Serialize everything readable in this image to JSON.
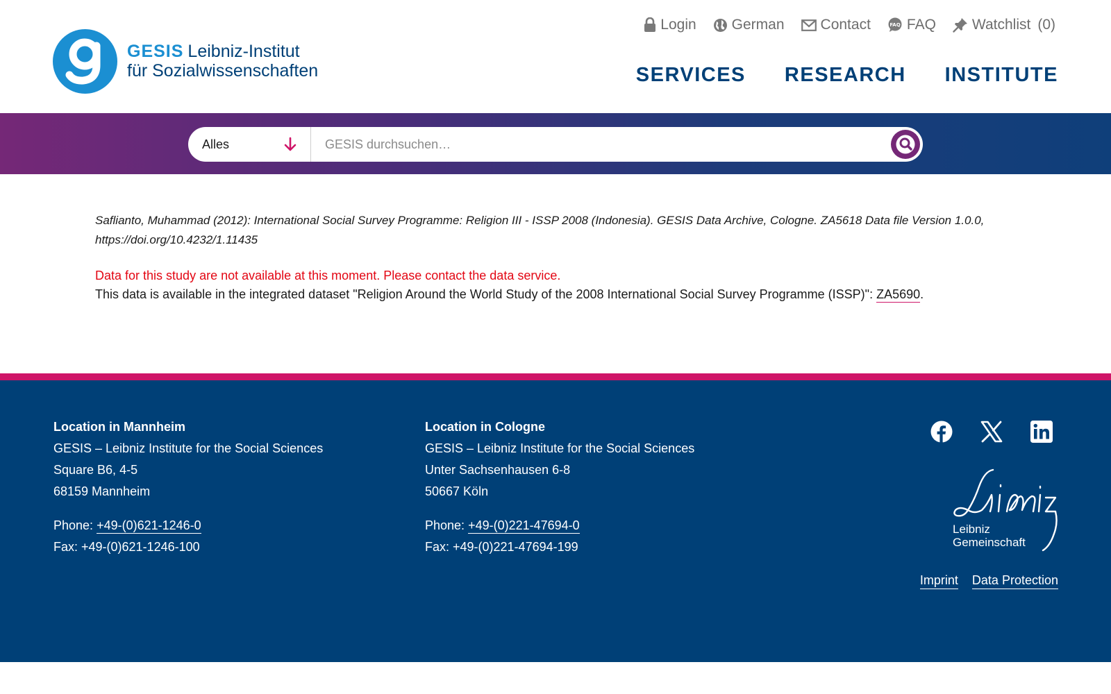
{
  "header": {
    "logo": {
      "brand": "GESIS",
      "line1": "Leibniz-Institut",
      "line2": "für Sozialwissenschaften"
    },
    "utility": {
      "login": "Login",
      "language": "German",
      "contact": "Contact",
      "faq": "FAQ",
      "watchlist": "Watchlist",
      "watchlist_count": "(0)"
    },
    "nav": {
      "services": "SERVICES",
      "research": "RESEARCH",
      "institute": "INSTITUTE"
    }
  },
  "search": {
    "scope_selected": "Alles",
    "placeholder": "GESIS durchsuchen…",
    "value": ""
  },
  "content": {
    "citation": "Saflianto, Muhammad (2012): International Social Survey Programme: Religion III - ISSP 2008 (Indonesia). GESIS Data Archive, Cologne. ZA5618 Data file Version 1.0.0, https://doi.org/10.4232/1.11435",
    "notice": "Data for this study are not available at this moment. Please contact the data service.",
    "available_prefix": "This data is available in the integrated dataset \"Religion Around the World Study of the 2008 International Social Survey Programme (ISSP)\": ",
    "dataset_link": "ZA5690",
    "available_suffix": "."
  },
  "footer": {
    "mannheim": {
      "title": "Location in Mannheim",
      "org": "GESIS – Leibniz Institute for the Social Sciences",
      "street": "Square B6, 4-5",
      "city": "68159 Mannheim",
      "phone_label": "Phone: ",
      "phone": "+49-(0)621-1246-0",
      "fax": "Fax: +49-(0)621-1246-100"
    },
    "cologne": {
      "title": "Location in Cologne",
      "org": "GESIS – Leibniz Institute for the Social Sciences",
      "street": "Unter Sachsenhausen 6-8",
      "city": "50667 Köln",
      "phone_label": "Phone: ",
      "phone": "+49-(0)221-47694-0",
      "fax": "Fax: +49-(0)221-47694-199"
    },
    "leibniz": {
      "line1": "Leibniz",
      "line2": "Gemeinschaft"
    },
    "legal": {
      "imprint": "Imprint",
      "privacy": "Data Protection"
    }
  },
  "colors": {
    "brand_blue": "#1b8fd2",
    "navy": "#004077",
    "magenta": "#cf1568",
    "purple": "#752877",
    "notice_red": "#e30613"
  },
  "icons": [
    "lock-icon",
    "globe-icon",
    "mail-icon",
    "faq-icon",
    "pin-icon",
    "chevron-down-icon",
    "search-icon",
    "facebook-icon",
    "x-icon",
    "linkedin-icon"
  ]
}
